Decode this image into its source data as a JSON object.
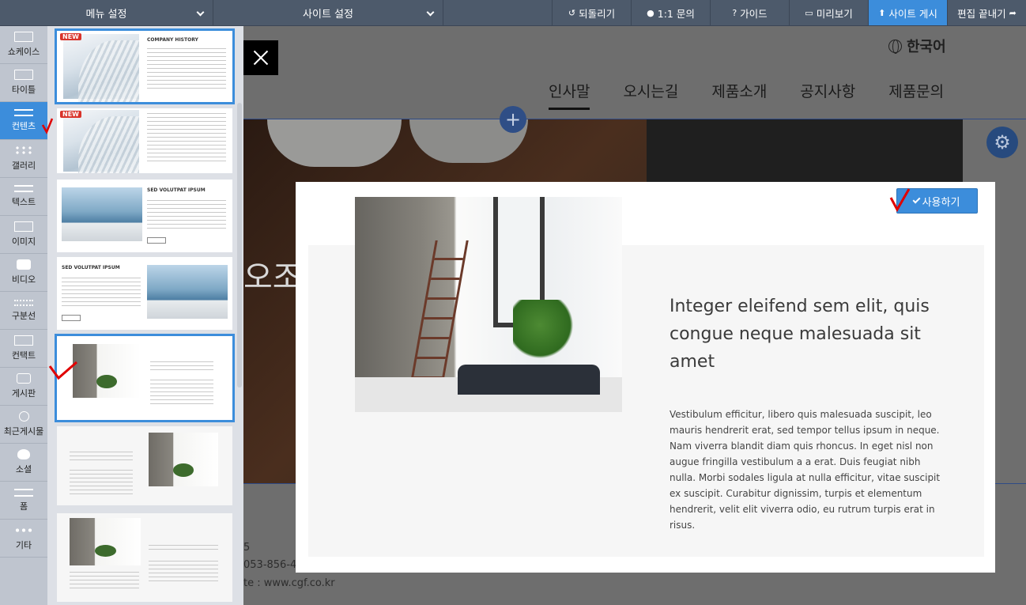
{
  "topbar": {
    "menu_settings": "메뉴 설정",
    "site_settings": "사이트 설정",
    "undo": "되돌리기",
    "inquiry": "1:1 문의",
    "guide": "가이드",
    "preview": "미리보기",
    "publish": "사이트 게시",
    "finish_edit": "편집 끝내기"
  },
  "categories": [
    {
      "label": "쇼케이스",
      "icon": "showcase-icon"
    },
    {
      "label": "타이틀",
      "icon": "title-icon"
    },
    {
      "label": "컨텐츠",
      "icon": "contents-icon",
      "active": true
    },
    {
      "label": "갤러리",
      "icon": "gallery-icon"
    },
    {
      "label": "텍스트",
      "icon": "text-icon"
    },
    {
      "label": "이미지",
      "icon": "image-icon"
    },
    {
      "label": "비디오",
      "icon": "video-icon"
    },
    {
      "label": "구분선",
      "icon": "divider-icon"
    },
    {
      "label": "컨택트",
      "icon": "mail-icon"
    },
    {
      "label": "게시판",
      "icon": "board-icon"
    },
    {
      "label": "최근게시물",
      "icon": "recent-posts-icon"
    },
    {
      "label": "소셜",
      "icon": "social-icon"
    },
    {
      "label": "폼",
      "icon": "form-icon"
    },
    {
      "label": "기타",
      "icon": "more-icon"
    }
  ],
  "templates": {
    "new_badge": "NEW",
    "t1_title": "COMPANY HISTORY",
    "t3_title": "SED VOLUTPAT IPSUM",
    "t4_title": "SED VOLUTPAT IPSUM"
  },
  "site": {
    "language": "한국어",
    "nav": [
      "인사말",
      "오시는길",
      "제품소개",
      "공지사항",
      "제품문의"
    ],
    "hero_text": "오조",
    "footer_line1": "5",
    "footer_line2": "053-856-4",
    "footer_line3": "te : www.cgf.co.kr"
  },
  "modal": {
    "use_button": "사용하기",
    "heading": "Integer eleifend sem elit, quis congue neque malesuada sit amet",
    "body": "Vestibulum efficitur, libero quis malesuada suscipit, leo mauris hendrerit erat, sed tempor tellus ipsum in neque. Nam viverra blandit diam quis rhoncus. In eget nisl non augue fringilla vestibulum a a erat. Duis feugiat nibh nulla. Morbi sodales ligula at nulla efficitur, vitae suscipit ex suscipit. Curabitur dignissim, turpis et elementum hendrerit, velit elit viverra odio, eu rutrum turpis erat in risus."
  },
  "colors": {
    "accent": "#3c8ddb",
    "topbar": "#4d5a6b",
    "annotation": "#e00000"
  }
}
